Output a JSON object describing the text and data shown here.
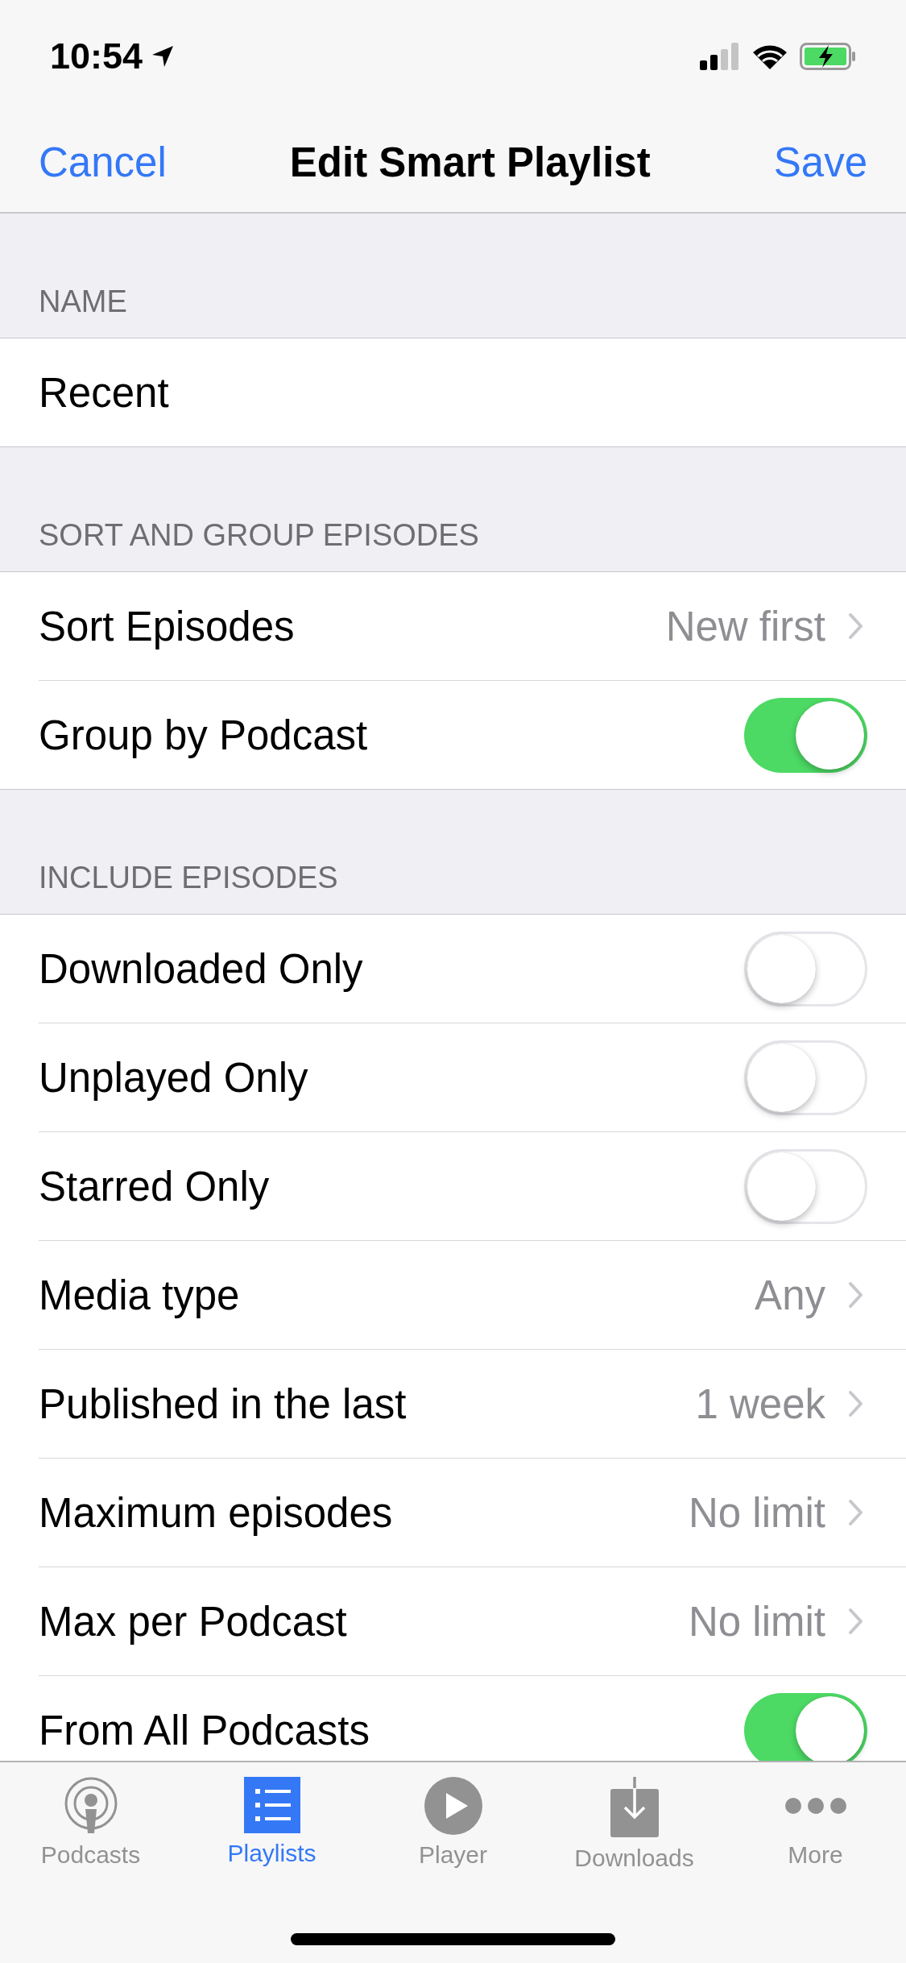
{
  "status_bar": {
    "time": "10:54"
  },
  "nav": {
    "cancel": "Cancel",
    "title": "Edit Smart Playlist",
    "save": "Save"
  },
  "sections": [
    {
      "header": "NAME",
      "rows": [
        {
          "kind": "field",
          "value": "Recent"
        }
      ]
    },
    {
      "header": "SORT AND GROUP EPISODES",
      "rows": [
        {
          "kind": "value",
          "label": "Sort Episodes",
          "value": "New first"
        },
        {
          "kind": "toggle",
          "label": "Group by Podcast",
          "on": true
        }
      ]
    },
    {
      "header": "INCLUDE EPISODES",
      "rows": [
        {
          "kind": "toggle",
          "label": "Downloaded Only",
          "on": false
        },
        {
          "kind": "toggle",
          "label": "Unplayed Only",
          "on": false
        },
        {
          "kind": "toggle",
          "label": "Starred Only",
          "on": false
        },
        {
          "kind": "value",
          "label": "Media type",
          "value": "Any"
        },
        {
          "kind": "value",
          "label": "Published in the last",
          "value": "1 week"
        },
        {
          "kind": "value",
          "label": "Maximum episodes",
          "value": "No limit"
        },
        {
          "kind": "value",
          "label": "Max per Podcast",
          "value": "No limit"
        },
        {
          "kind": "toggle",
          "label": "From All Podcasts",
          "on": true
        }
      ]
    }
  ],
  "tabs": [
    {
      "kind": "podcasts",
      "label": "Podcasts",
      "selected": false
    },
    {
      "kind": "playlists",
      "label": "Playlists",
      "selected": true
    },
    {
      "kind": "player",
      "label": "Player",
      "selected": false
    },
    {
      "kind": "downloads",
      "label": "Downloads",
      "selected": false
    },
    {
      "kind": "more",
      "label": "More",
      "selected": false
    }
  ]
}
